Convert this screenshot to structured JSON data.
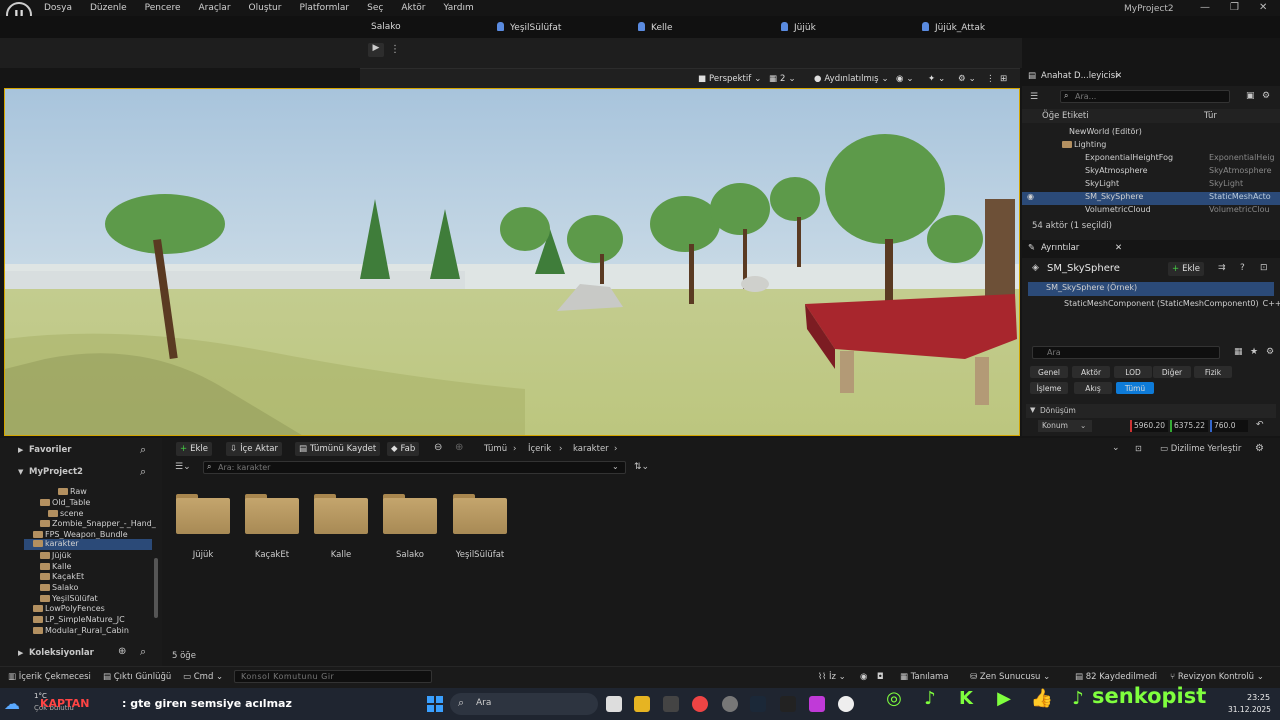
{
  "app": {
    "title": "MyProject2"
  },
  "menu": [
    "Dosya",
    "Düzenle",
    "Pencere",
    "Araçlar",
    "Oluştur",
    "Platformlar",
    "Seç",
    "Aktör",
    "Yardım"
  ],
  "level_tabs": [
    {
      "label": "Salako"
    },
    {
      "label": "YeşilSülüfat"
    },
    {
      "label": "Kelle"
    },
    {
      "label": "Jüjük"
    },
    {
      "label": "Jüjük_Attak"
    }
  ],
  "viewport": {
    "perspective": "Perspektif",
    "view_count": "2",
    "lighting": "Aydınlatılmış"
  },
  "outliner": {
    "tab": "Anahat D...leyicisi",
    "search_placeholder": "Ara...",
    "col_label": "Öğe Etiketi",
    "col_type": "Tür",
    "rows": [
      {
        "label": "NewWorld (Editör)",
        "type": ""
      },
      {
        "label": "Lighting",
        "type": ""
      },
      {
        "label": "ExponentialHeightFog",
        "type": "ExponentialHeig"
      },
      {
        "label": "SkyAtmosphere",
        "type": "SkyAtmosphere"
      },
      {
        "label": "SkyLight",
        "type": "SkyLight"
      },
      {
        "label": "SM_SkySphere",
        "type": "StaticMeshActo"
      },
      {
        "label": "VolumetricCloud",
        "type": "VolumetricClou"
      }
    ],
    "count": "54 aktör (1 seçildi)"
  },
  "details": {
    "tab": "Ayrıntılar",
    "actor": "SM_SkySphere",
    "add": "Ekle",
    "instance": "SM_SkySphere (Örnek)",
    "component": "StaticMeshComponent (StaticMeshComponent0)",
    "component_type": "C++",
    "search_placeholder": "Ara",
    "filters": [
      "Genel",
      "Aktör",
      "LOD",
      "Diğer",
      "Fizik",
      "İşleme",
      "Akış",
      "Tümü"
    ],
    "section": "Dönüşüm",
    "location_label": "Konum",
    "loc_x": "5960.20",
    "loc_y": "6375.22",
    "loc_z": "760.0"
  },
  "content": {
    "favorites": "Favoriler",
    "project": "MyProject2",
    "collections": "Koleksiyonlar",
    "add": "Ekle",
    "import": "İçe Aktar",
    "save_all": "Tümünü Kaydet",
    "fab": "Fab",
    "breadcrumb": [
      "Tümü",
      "İçerik",
      "karakter"
    ],
    "dock": "Dizilime Yerleştir",
    "search_placeholder": "Ara: karakter",
    "tree": [
      {
        "label": "Raw",
        "indent": 4
      },
      {
        "label": "Old_Table",
        "indent": 2
      },
      {
        "label": "scene",
        "indent": 3
      },
      {
        "label": "Zombie_Snapper_-_Hand_",
        "indent": 2
      },
      {
        "label": "FPS_Weapon_Bundle",
        "indent": 1
      },
      {
        "label": "karakter",
        "indent": 1
      },
      {
        "label": "Jüjük",
        "indent": 2
      },
      {
        "label": "Kalle",
        "indent": 2
      },
      {
        "label": "KaçakEt",
        "indent": 2
      },
      {
        "label": "Salako",
        "indent": 2
      },
      {
        "label": "YeşilSülüfat",
        "indent": 2
      },
      {
        "label": "LowPolyFences",
        "indent": 1
      },
      {
        "label": "LP_SimpleNature_JC",
        "indent": 1
      },
      {
        "label": "Modular_Rural_Cabin",
        "indent": 1
      }
    ],
    "folders": [
      "Jüjük",
      "KaçakEt",
      "Kalle",
      "Salako",
      "YeşilSülüfat"
    ],
    "item_count": "5 öğe"
  },
  "statusbar": {
    "content_drawer": "İçerik Çekmecesi",
    "output_log": "Çıktı Günlüğü",
    "cmd": "Cmd",
    "console_placeholder": "Konsol Komutunu Gir",
    "trace": "İz",
    "diagnose": "Tanılama",
    "zen": "Zen Sunucusu",
    "saved": "82 Kaydedilmedi",
    "revision": "Revizyon Kontrolü"
  },
  "taskbar": {
    "search": "Ara",
    "time": "23:25",
    "date": "31.12.2025",
    "temp": "1°C",
    "weather": "Çok bulutlu"
  },
  "stream": {
    "chat_user": "KAPTAN",
    "chat_message": ": gte giren semsiye acılmaz",
    "brand": "senkopist"
  },
  "colors": {
    "accent": "#0e7bd8",
    "selection": "#2b4a78",
    "viewport_border": "#d4a500",
    "social": "#7fff3e"
  }
}
